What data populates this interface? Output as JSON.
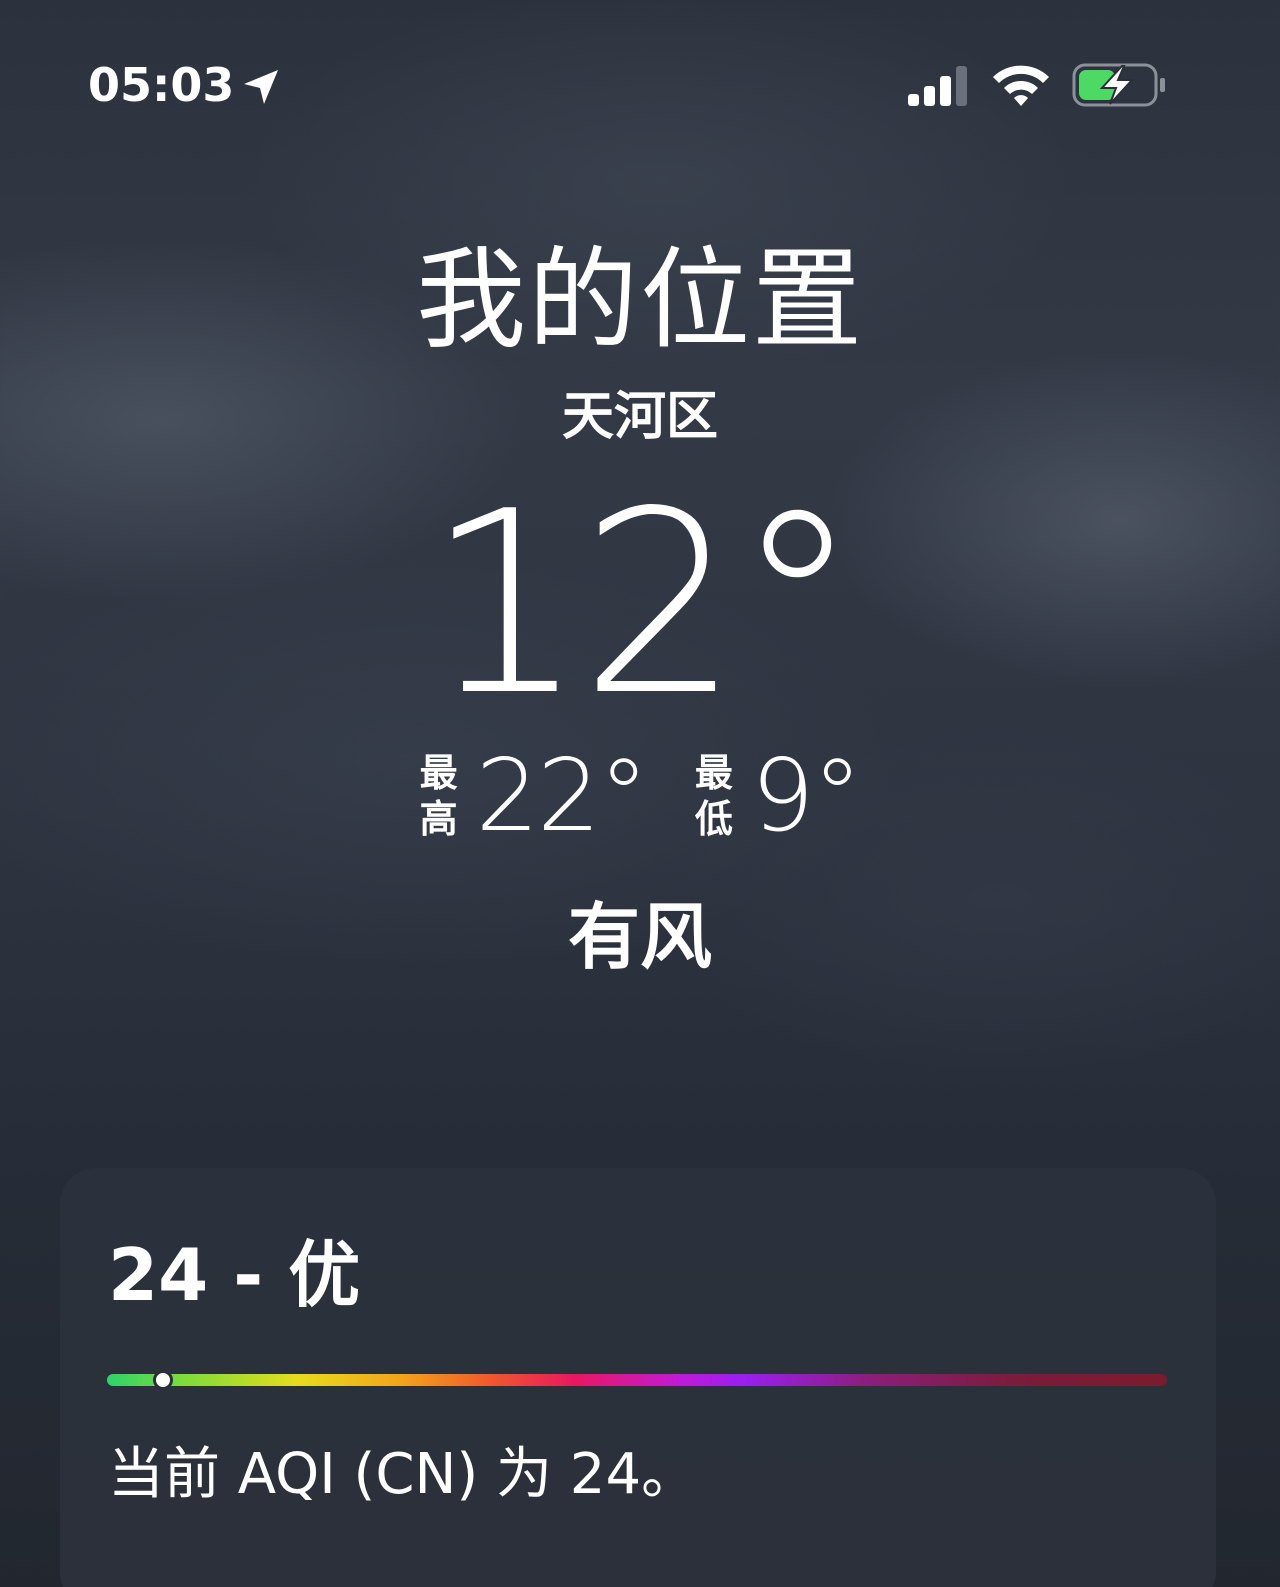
{
  "status_bar": {
    "time": "05:03",
    "icons": [
      "location-arrow-icon",
      "cellular-signal-icon",
      "wifi-icon",
      "battery-charging-icon"
    ],
    "battery_color": "#4cd964"
  },
  "location": {
    "title": "我的位置",
    "subtitle": "天河区"
  },
  "weather": {
    "current_temp": "12°",
    "high_label_1": "最",
    "high_label_2": "高",
    "high_value": "22°",
    "low_label_1": "最",
    "low_label_2": "低",
    "low_value": "9°",
    "condition": "有风"
  },
  "aqi": {
    "headline": "24 - 优",
    "value": 24,
    "indicator_fraction": 0.053,
    "description": "当前 AQI (CN) 为 24。"
  }
}
